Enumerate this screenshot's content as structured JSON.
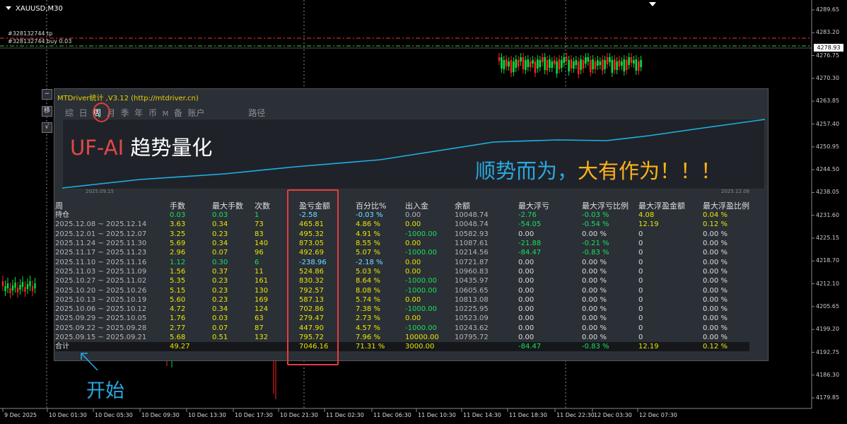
{
  "chart": {
    "symbol": "XAUUSD,M30",
    "order_tp_label": "#328132744 tp",
    "order_buy_label": "#328132744 buy 0.03",
    "current_price": "4278.93",
    "price_labels": [
      "4289.65",
      "4283.20",
      "4276.75",
      "4270.30",
      "4263.85",
      "4257.40",
      "4250.95",
      "4244.50",
      "4238.05",
      "4231.60",
      "4225.15",
      "4218.70",
      "4212.10",
      "4205.65",
      "4199.20",
      "4192.75",
      "4186.30",
      "4179.85"
    ],
    "time_labels": [
      "9 Dec 2025",
      "10 Dec 01:30",
      "10 Dec 05:30",
      "10 Dec 09:30",
      "10 Dec 13:30",
      "10 Dec 17:30",
      "10 Dec 21:30",
      "11 Dec 02:30",
      "11 Dec 06:30",
      "11 Dec 10:30",
      "11 Dec 14:30",
      "11 Dec 18:30",
      "11 Dec 22:30",
      "12 Dec 03:30",
      "12 Dec 07:30"
    ],
    "colors": {
      "bull": "#00e040",
      "bear": "#ff2020",
      "tp_line": "#ff3030",
      "buy_line": "#3cc83c"
    }
  },
  "panel": {
    "title": "MTDriver统计 ,V3.12 (http://mtdriver.cn)",
    "minimize_label": "−",
    "side_buttons": [
      "移",
      "√"
    ],
    "tabs": [
      "综",
      "日",
      "周",
      "月",
      "季",
      "年",
      "币",
      "M",
      "备",
      "账户",
      "路径"
    ],
    "active_tab": "周",
    "curve_start": "2025.09.15",
    "curve_end": "2025.12.08",
    "slogan1_red": "UF-AI",
    "slogan1_white": "趋势量化",
    "slogan2_blue": "顺势而为，",
    "slogan2_orange": "大有作为！！！"
  },
  "annotation": {
    "start_label": "开始"
  },
  "table": {
    "headers": [
      "周",
      "手数",
      "最大手数",
      "次数",
      "盈亏金额",
      "百分比%",
      "出入金",
      "余额",
      "最大浮亏",
      "最大浮亏比例",
      "最大浮盈金额",
      "最大浮盈比例"
    ],
    "position_row": [
      "持仓",
      "0.03",
      "0.03",
      "1",
      "-2.58",
      "-0.03 %",
      "0.00",
      "10048.74",
      "-2.76",
      "-0.03 %",
      "4.08",
      "0.04 %"
    ],
    "rows": [
      [
        "2025.12.08 ~ 2025.12.14",
        "3.63",
        "0.34",
        "73",
        "465.81",
        "4.86 %",
        "0.00",
        "10048.74",
        "-54.05",
        "-0.54 %",
        "12.19",
        "0.12 %"
      ],
      [
        "2025.12.01 ~ 2025.12.07",
        "3.25",
        "0.23",
        "83",
        "495.32",
        "4.91 %",
        "-1000.00",
        "10582.93",
        "0.00",
        "0.00 %",
        "0",
        "0.00 %"
      ],
      [
        "2025.11.24 ~ 2025.11.30",
        "5.69",
        "0.34",
        "140",
        "873.05",
        "8.55 %",
        "0.00",
        "11087.61",
        "-21.88",
        "-0.21 %",
        "0",
        "0.00 %"
      ],
      [
        "2025.11.17 ~ 2025.11.23",
        "2.96",
        "0.07",
        "96",
        "492.69",
        "5.07 %",
        "-1000.00",
        "10214.56",
        "-84.47",
        "-0.83 %",
        "0",
        "0.00 %"
      ],
      [
        "2025.11.10 ~ 2025.11.16",
        "1.12",
        "0.30",
        "6",
        "-238.96",
        "-2.18 %",
        "0.00",
        "10721.87",
        "0.00",
        "0.00 %",
        "0",
        "0.00 %"
      ],
      [
        "2025.11.03 ~ 2025.11.09",
        "1.56",
        "0.37",
        "11",
        "524.86",
        "5.03 %",
        "0.00",
        "10960.83",
        "0.00",
        "0.00 %",
        "0",
        "0.00 %"
      ],
      [
        "2025.10.27 ~ 2025.11.02",
        "5.35",
        "0.23",
        "161",
        "830.32",
        "8.64 %",
        "-1000.00",
        "10435.97",
        "0.00",
        "0.00 %",
        "0",
        "0.00 %"
      ],
      [
        "2025.10.20 ~ 2025.10.26",
        "5.15",
        "0.23",
        "130",
        "792.57",
        "8.08 %",
        "-1000.00",
        "10605.65",
        "0.00",
        "0.00 %",
        "0",
        "0.00 %"
      ],
      [
        "2025.10.13 ~ 2025.10.19",
        "5.60",
        "0.23",
        "169",
        "587.13",
        "5.74 %",
        "0.00",
        "10813.08",
        "0.00",
        "0.00 %",
        "0",
        "0.00 %"
      ],
      [
        "2025.10.06 ~ 2025.10.12",
        "4.72",
        "0.34",
        "124",
        "702.86",
        "7.38 %",
        "-1000.00",
        "10225.95",
        "0.00",
        "0.00 %",
        "0",
        "0.00 %"
      ],
      [
        "2025.09.29 ~ 2025.10.05",
        "1.76",
        "0.03",
        "63",
        "279.47",
        "2.73 %",
        "0.00",
        "10523.09",
        "0.00",
        "0.00 %",
        "0",
        "0.00 %"
      ],
      [
        "2025.09.22 ~ 2025.09.28",
        "2.77",
        "0.07",
        "87",
        "447.90",
        "4.57 %",
        "-1000.00",
        "10243.62",
        "0.00",
        "0.00 %",
        "0",
        "0.00 %"
      ],
      [
        "2025.09.15 ~ 2025.09.21",
        "5.68",
        "0.51",
        "132",
        "795.72",
        "7.96 %",
        "10000.00",
        "10795.72",
        "0.00",
        "0.00 %",
        "0",
        "0.00 %"
      ]
    ],
    "total_row": [
      "合计",
      "49.27",
      "",
      "",
      "7046.16",
      "71.31 %",
      "3000.00",
      "",
      "-84.47",
      "-0.83 %",
      "12.19",
      "0.12 %"
    ]
  }
}
